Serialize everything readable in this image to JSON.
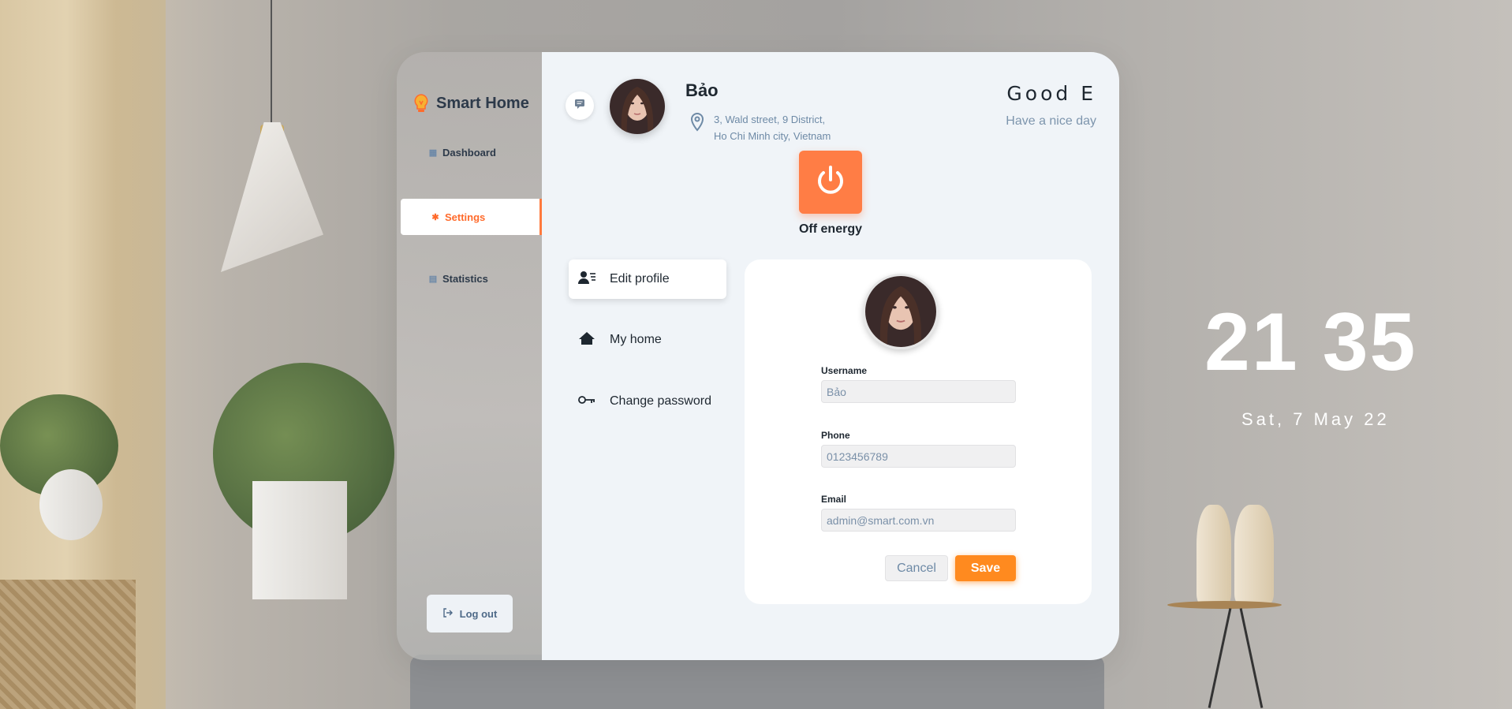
{
  "app": {
    "brand": "Smart Home"
  },
  "sidebar": {
    "items": [
      {
        "label": "Dashboard",
        "icon": "grid-icon",
        "active": false
      },
      {
        "label": "Settings",
        "icon": "gear-icon",
        "active": true
      },
      {
        "label": "Statistics",
        "icon": "chart-icon",
        "active": false
      }
    ],
    "logout_label": "Log out"
  },
  "header": {
    "user_name": "Bảo",
    "address_line1": "3, Wald street, 9 District,",
    "address_line2": "Ho Chi Minh city, Vietnam",
    "greeting": "Good E",
    "greeting_sub": "Have a nice day"
  },
  "power": {
    "label": "Off energy",
    "color": "#ff7d45"
  },
  "settings_menu": [
    {
      "label": "Edit profile",
      "icon": "user-list-icon",
      "active": true
    },
    {
      "label": "My home",
      "icon": "home-icon",
      "active": false
    },
    {
      "label": "Change password",
      "icon": "key-icon",
      "active": false
    }
  ],
  "form": {
    "username_label": "Username",
    "username_value": "Bảo",
    "phone_label": "Phone",
    "phone_value": "0123456789",
    "email_label": "Email",
    "email_value": "admin@smart.com.vn",
    "cancel_label": "Cancel",
    "save_label": "Save"
  },
  "clock": {
    "hours": "21",
    "minutes": "35",
    "date": "Sat, 7 May 22"
  },
  "colors": {
    "accent": "#ff7a3d",
    "save": "#ff8a1f",
    "text_muted": "#6e8aa6"
  }
}
